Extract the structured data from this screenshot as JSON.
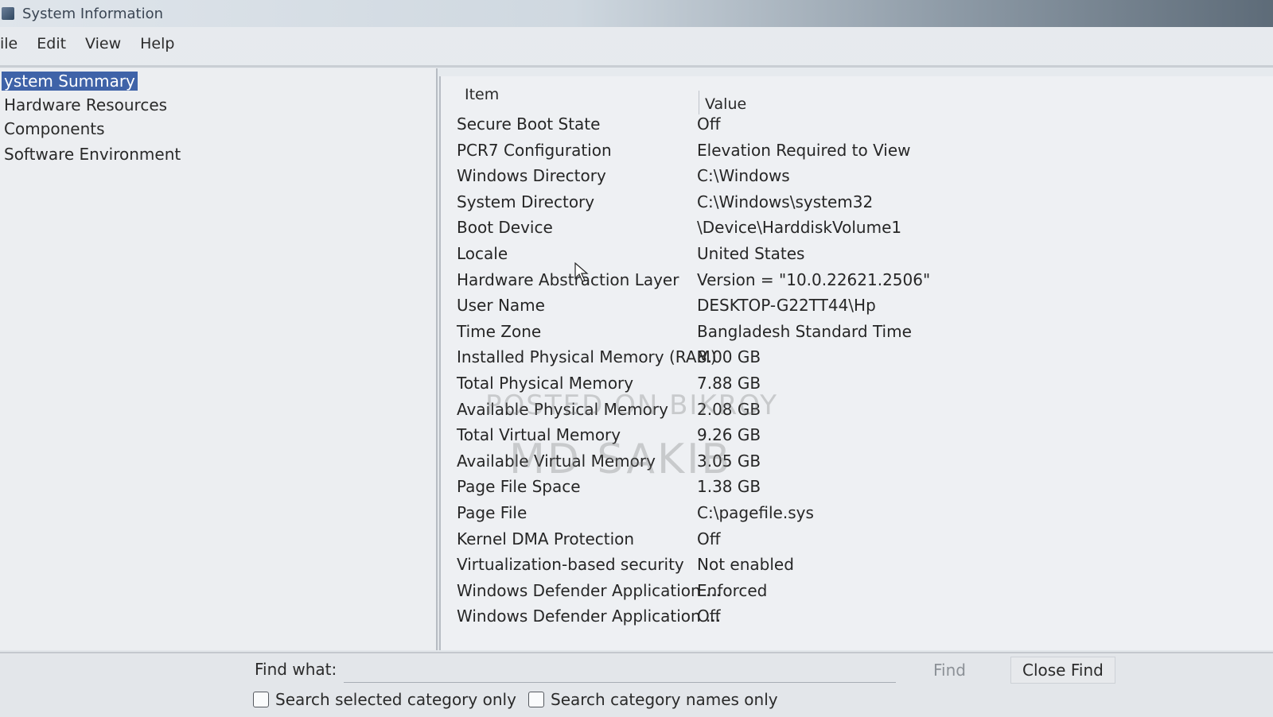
{
  "window": {
    "title": "System Information",
    "icon": "system-information-icon"
  },
  "menu": {
    "items": [
      "ile",
      "Edit",
      "View",
      "Help"
    ]
  },
  "tree": {
    "items": [
      {
        "label": "ystem Summary",
        "selected": true
      },
      {
        "label": "Hardware Resources",
        "selected": false
      },
      {
        "label": "Components",
        "selected": false
      },
      {
        "label": "Software Environment",
        "selected": false
      }
    ]
  },
  "table": {
    "headers": {
      "item": "Item",
      "value": "Value"
    },
    "rows": [
      {
        "item": "Secure Boot State",
        "value": "Off"
      },
      {
        "item": "PCR7 Configuration",
        "value": "Elevation Required to View"
      },
      {
        "item": "Windows Directory",
        "value": "C:\\Windows"
      },
      {
        "item": "System Directory",
        "value": "C:\\Windows\\system32"
      },
      {
        "item": "Boot Device",
        "value": "\\Device\\HarddiskVolume1"
      },
      {
        "item": "Locale",
        "value": "United States"
      },
      {
        "item": "Hardware Abstraction Layer",
        "value": "Version = \"10.0.22621.2506\""
      },
      {
        "item": "User Name",
        "value": "DESKTOP-G22TT44\\Hp"
      },
      {
        "item": "Time Zone",
        "value": "Bangladesh Standard Time"
      },
      {
        "item": "Installed Physical Memory (RAM)",
        "value": "8.00 GB"
      },
      {
        "item": "Total Physical Memory",
        "value": "7.88 GB"
      },
      {
        "item": "Available Physical Memory",
        "value": "2.08 GB"
      },
      {
        "item": "Total Virtual Memory",
        "value": "9.26 GB"
      },
      {
        "item": "Available Virtual Memory",
        "value": "3.05 GB"
      },
      {
        "item": "Page File Space",
        "value": "1.38 GB"
      },
      {
        "item": "Page File",
        "value": "C:\\pagefile.sys"
      },
      {
        "item": "Kernel DMA Protection",
        "value": "Off"
      },
      {
        "item": "Virtualization-based security",
        "value": "Not enabled"
      },
      {
        "item": "Windows Defender Application ...",
        "value": "Enforced"
      },
      {
        "item": "Windows Defender Application ...",
        "value": "Off"
      }
    ]
  },
  "watermark": {
    "line1": "POSTED ON BIKROY",
    "line2": "MD SAKIB"
  },
  "find": {
    "label": "Find what:",
    "value": "",
    "find_button": "Find",
    "close_button": "Close Find",
    "check_selected": "Search selected category only",
    "check_names": "Search category names only"
  },
  "colors": {
    "selection": "#3f63a8"
  }
}
